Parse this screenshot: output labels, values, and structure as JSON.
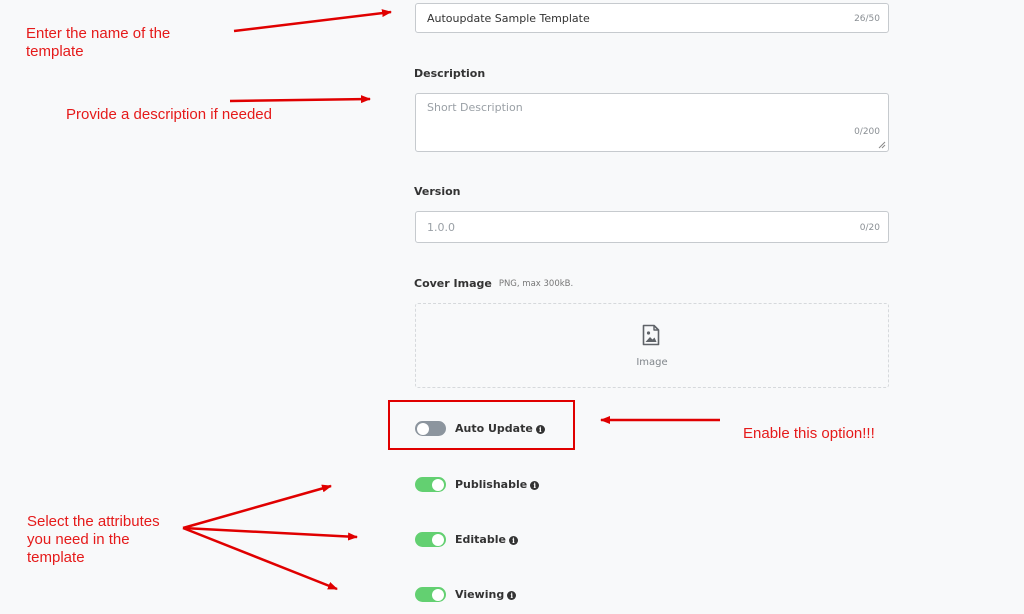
{
  "form": {
    "name": {
      "value": "Autoupdate Sample Template",
      "counter": "26/50"
    },
    "description": {
      "label": "Description",
      "placeholder": "Short Description",
      "counter": "0/200"
    },
    "version": {
      "label": "Version",
      "placeholder": "1.0.0",
      "counter": "0/20"
    },
    "cover_image": {
      "label": "Cover Image",
      "hint": "PNG, max 300kB.",
      "dropzone_label": "Image",
      "icon": "image-icon"
    },
    "toggles": [
      {
        "label": "Auto Update",
        "on": false
      },
      {
        "label": "Publishable",
        "on": true
      },
      {
        "label": "Editable",
        "on": true
      },
      {
        "label": "Viewing",
        "on": true
      }
    ],
    "info_icon_glyph": "i"
  },
  "annotations": {
    "name_note": [
      "Enter the name of the",
      "template"
    ],
    "description_note": "Provide a description if needed",
    "auto_update_note": "Enable this option!!!",
    "attributes_note": [
      "Select the attributes",
      "you need in the",
      "template"
    ]
  },
  "colors": {
    "toggle_on": "#63d071",
    "toggle_off": "#8c959e",
    "annotation_red": "#e51a1a"
  }
}
